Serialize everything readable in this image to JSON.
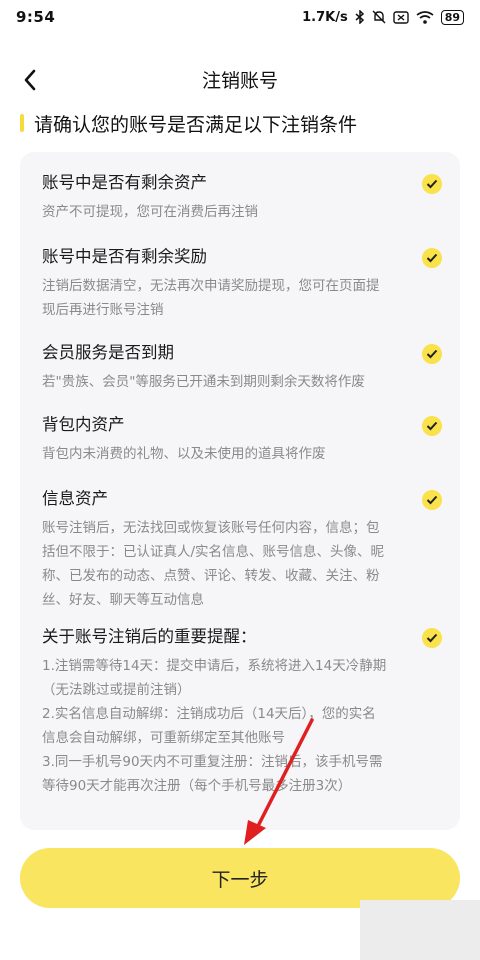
{
  "status_bar": {
    "time": "9:54",
    "network_speed": "1.7K/s",
    "battery": "89",
    "icons": [
      "bluetooth-icon",
      "mute-icon",
      "no-sim-icon",
      "wifi-icon",
      "battery-icon"
    ]
  },
  "nav": {
    "back_icon": "chevron-left-icon",
    "title": "注销账号"
  },
  "heading": "请确认您的账号是否满足以下注销条件",
  "conditions": [
    {
      "title": "账号中是否有剩余资产",
      "desc": "资产不可提现，您可在消费后再注销",
      "checked": true
    },
    {
      "title": "账号中是否有剩余奖励",
      "desc": "注销后数据清空，无法再次申请奖励提现，您可在页面提\n现后再进行账号注销",
      "checked": true
    },
    {
      "title": "会员服务是否到期",
      "desc": "若\"贵族、会员\"等服务已开通未到期则剩余天数将作废",
      "checked": true
    },
    {
      "title": "背包内资产",
      "desc": "背包内未消费的礼物、以及未使用的道具将作废",
      "checked": true
    },
    {
      "title": "信息资产",
      "desc": "账号注销后，无法找回或恢复该账号任何内容，信息；包\n括但不限于：已认证真人/实名信息、账号信息、头像、昵\n称、已发布的动态、点赞、评论、转发、收藏、关注、粉\n丝、好友、聊天等互动信息",
      "checked": true
    },
    {
      "title": "关于账号注销后的重要提醒：",
      "desc": "1.注销需等待14天：提交申请后，系统将进入14天冷静期\n（无法跳过或提前注销）\n2.实名信息自动解绑：注销成功后（14天后），您的实名\n信息会自动解绑，可重新绑定至其他账号\n3.同一手机号90天内不可重复注册：注销后，该手机号需\n等待90天才能再次注册（每个手机号最多注册3次）",
      "checked": true
    }
  ],
  "next_button": "下一步",
  "colors": {
    "accent_yellow": "#f9e24a",
    "button_yellow": "#f9e560",
    "arrow_red": "#e02020",
    "card_bg": "#f6f6f8"
  }
}
